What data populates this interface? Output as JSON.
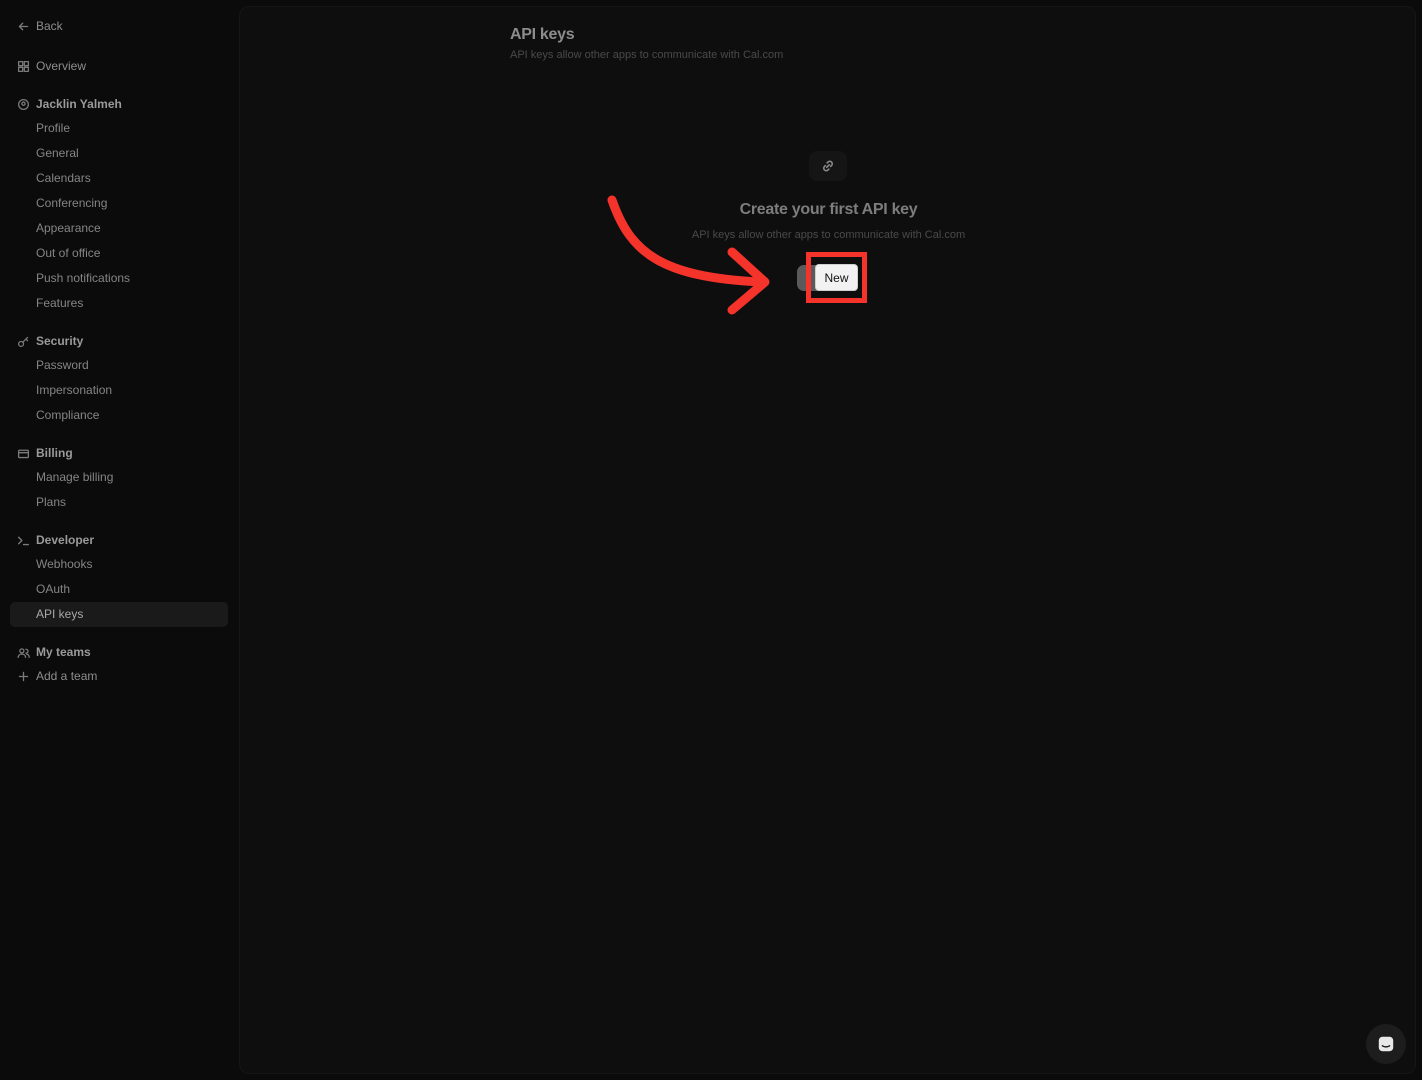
{
  "sidebar": {
    "back_label": "Back",
    "overview_label": "Overview",
    "groups": [
      {
        "icon": "user-circle-icon",
        "label": "Jacklin Yalmeh",
        "items": [
          "Profile",
          "General",
          "Calendars",
          "Conferencing",
          "Appearance",
          "Out of office",
          "Push notifications",
          "Features"
        ]
      },
      {
        "icon": "key-icon",
        "label": "Security",
        "items": [
          "Password",
          "Impersonation",
          "Compliance"
        ]
      },
      {
        "icon": "credit-card-icon",
        "label": "Billing",
        "items": [
          "Manage billing",
          "Plans"
        ]
      },
      {
        "icon": "terminal-icon",
        "label": "Developer",
        "items": [
          "Webhooks",
          "OAuth",
          "API keys"
        ]
      }
    ],
    "active_item": "API keys",
    "teams_label": "My teams",
    "add_team_label": "Add a team"
  },
  "header": {
    "title": "API keys",
    "subtitle": "API keys allow other apps to communicate with Cal.com"
  },
  "empty_state": {
    "icon": "link-icon",
    "title": "Create your first API key",
    "subtitle": "API keys allow other apps to communicate with Cal.com",
    "button_label": "New"
  },
  "colors": {
    "highlight": "#f4332b",
    "background": "#0b0b0b"
  }
}
